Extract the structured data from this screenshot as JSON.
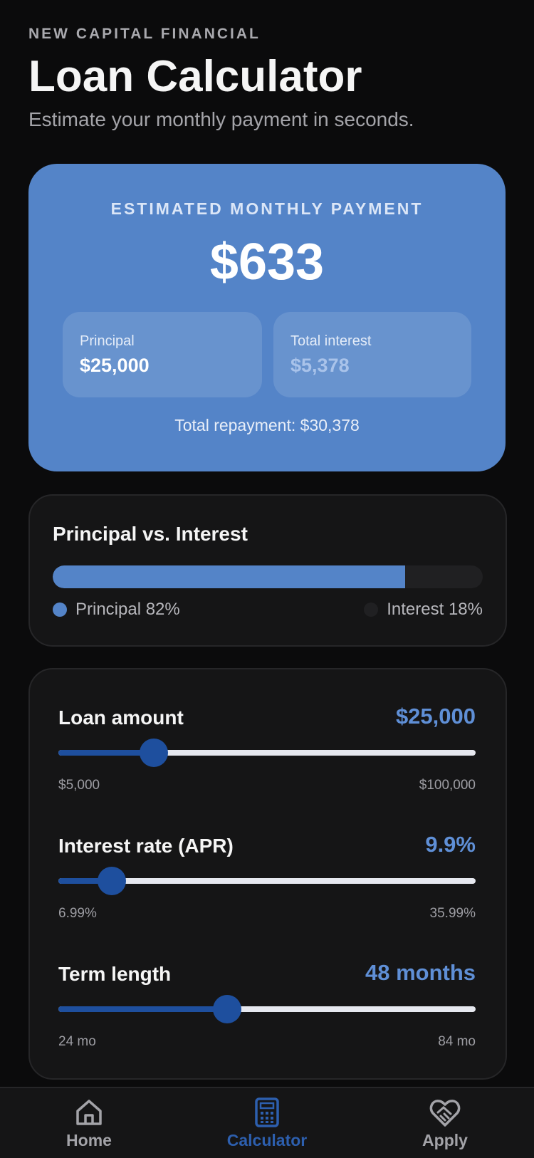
{
  "header": {
    "brand": "NEW CAPITAL FINANCIAL",
    "title": "Loan Calculator",
    "subtitle": "Estimate your monthly payment in seconds."
  },
  "summary": {
    "label": "ESTIMATED MONTHLY PAYMENT",
    "monthly_payment": "$633",
    "principal_label": "Principal",
    "principal_value": "$25,000",
    "interest_label": "Total interest",
    "interest_value": "$5,378",
    "total_repayment": "Total repayment: $30,378",
    "accent_color": "#5484c8"
  },
  "breakdown": {
    "title": "Principal vs. Interest",
    "principal_fraction": 0.82,
    "principal_legend": "Principal 82%",
    "interest_legend": "Interest 18%",
    "principal_color": "#5484c8",
    "interest_color": "#202022"
  },
  "sliders": [
    {
      "label": "Loan amount",
      "value": "$25,000",
      "min": "$5,000",
      "max": "$100,000",
      "fraction": 0.228
    },
    {
      "label": "Interest rate (APR)",
      "value": "9.9%",
      "min": "6.99%",
      "max": "35.99%",
      "fraction": 0.128
    },
    {
      "label": "Term length",
      "value": "48 months",
      "min": "24 mo",
      "max": "84 mo",
      "fraction": 0.405
    }
  ],
  "nav": {
    "items": [
      {
        "label": "Home",
        "icon": "home-icon"
      },
      {
        "label": "Calculator",
        "icon": "calculator-icon",
        "active": true
      },
      {
        "label": "Apply",
        "icon": "handshake-heart-icon"
      }
    ]
  }
}
